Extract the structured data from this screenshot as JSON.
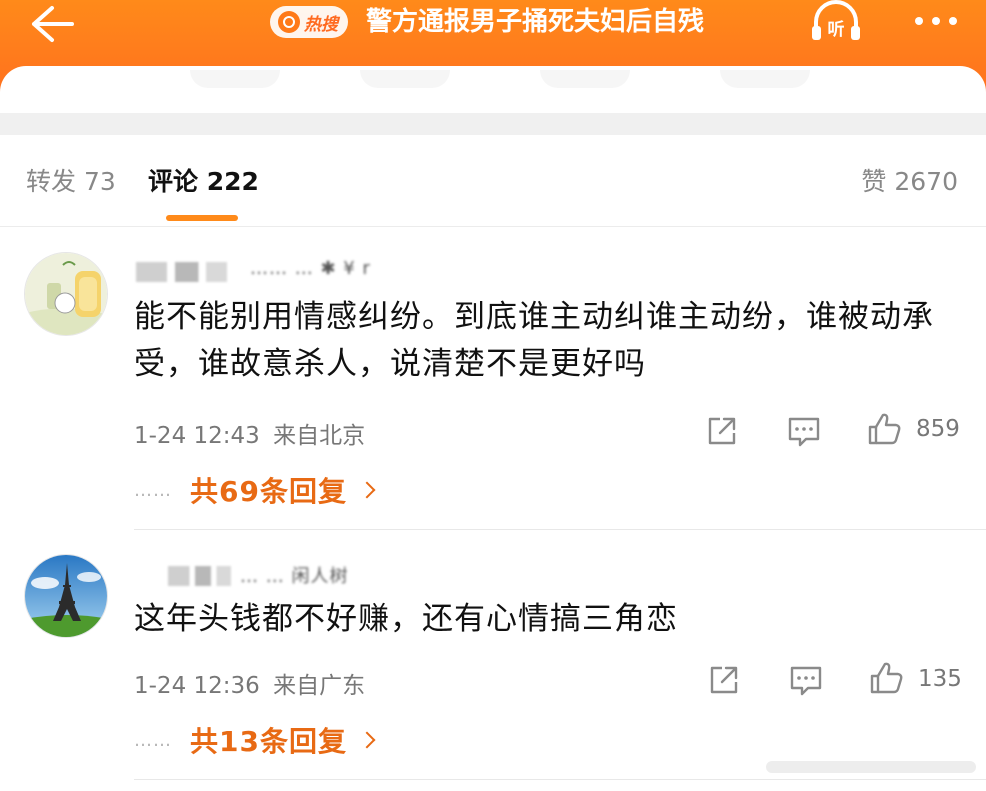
{
  "header": {
    "hot_badge": "热搜",
    "title": "警方通报男子捅死夫妇后自残",
    "listen_label": "听",
    "brand_color": "#ff7a18"
  },
  "tabs": {
    "repost_label": "转发",
    "repost_count": "73",
    "comment_label": "评论",
    "comment_count": "222",
    "like_label": "赞",
    "like_count": "2670"
  },
  "comments": [
    {
      "username": "…… … ✱ ¥ r",
      "text": "能不能别用情感纠纷。到底谁主动纠谁主动纷，谁被动承受，谁故意杀人，说清楚不是更好吗",
      "time": "1-24 12:43",
      "location": "来自北京",
      "likes": "859",
      "reply_dots": "……",
      "replies_label": "共69条回复"
    },
    {
      "username": "… … 闲人树",
      "text": "这年头钱都不好赚，还有心情搞三角恋",
      "time": "1-24 12:36",
      "location": "来自广东",
      "likes": "135",
      "reply_dots": "……",
      "replies_label": "共13条回复"
    }
  ]
}
